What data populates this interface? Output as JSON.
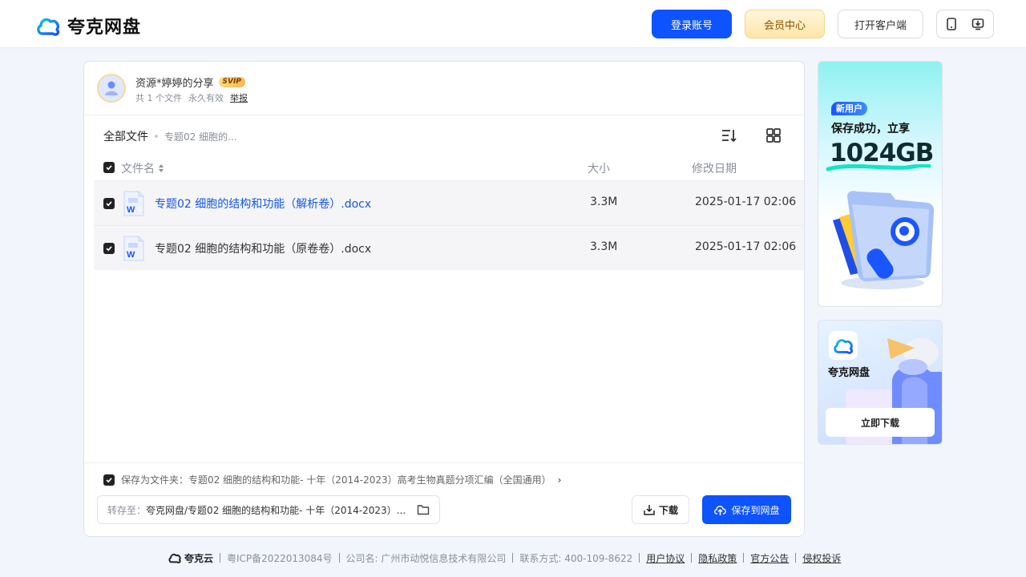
{
  "header": {
    "brand": "夸克网盘",
    "login_label": "登录账号",
    "vip_label": "会员中心",
    "client_label": "打开客户端"
  },
  "share": {
    "title": "资源*婷婷的分享",
    "badge": "SVIP",
    "file_count": "共 1 个文件",
    "validity": "永久有效",
    "report": "举报"
  },
  "breadcrumb": {
    "root": "全部文件",
    "current": "专题02 细胞的..."
  },
  "table": {
    "columns": {
      "name": "文件名",
      "size": "大小",
      "date": "修改日期"
    },
    "rows": [
      {
        "name": "专题02 细胞的结构和功能（解析卷）.docx",
        "size": "3.3M",
        "date": "2025-01-17 02:06"
      },
      {
        "name": "专题02 细胞的结构和功能（原卷卷）.docx",
        "size": "3.3M",
        "date": "2025-01-17 02:06"
      }
    ]
  },
  "save": {
    "folder_label": "保存为文件夹：专题02 细胞的结构和功能- 十年（2014-2023）高考生物真题分项汇编（全国通用）",
    "chevron": "›",
    "saveto_label": "转存至：",
    "saveto_path": "夸克网盘/专题02 细胞的结构和功能- 十年（2014-2023）...",
    "download_label": "下载",
    "save_label": "保存到网盘"
  },
  "ads": {
    "ad1_tag": "新用户",
    "ad1_line": "保存成功，立享",
    "ad1_big": "1024GB",
    "ad2_name": "夸克网盘",
    "ad2_button": "立即下载"
  },
  "footer": {
    "logo": "夸克云",
    "icp": "粤ICP备2022013084号",
    "company": "公司名: 广州市动悦信息技术有限公司",
    "contact": "联系方式: 400-109-8622",
    "links": [
      "用户协议",
      "隐私政策",
      "官方公告",
      "侵权投诉"
    ]
  },
  "colors": {
    "primary": "#0d53ff",
    "link": "#1456e6",
    "background": "#f2f5fc"
  }
}
